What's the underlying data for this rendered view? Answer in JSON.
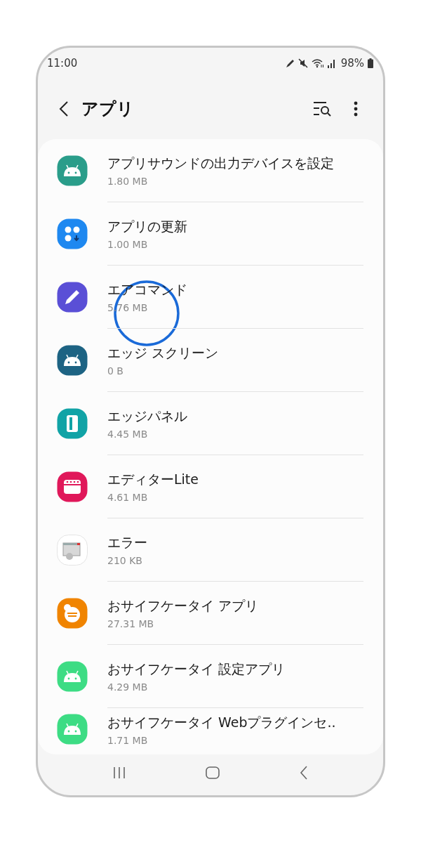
{
  "status_bar": {
    "time": "11:00",
    "battery": "98%"
  },
  "header": {
    "title": "アプリ"
  },
  "apps": [
    {
      "name": "アプリサウンドの出力デバイスを設定",
      "size": "1.80 MB",
      "kind": "android",
      "color": "#2a9d8a",
      "touched": false
    },
    {
      "name": "アプリの更新",
      "size": "1.00 MB",
      "kind": "dots",
      "color": "#1e88f0",
      "touched": false
    },
    {
      "name": "エアコマンド",
      "size": "5.76 MB",
      "kind": "pencil",
      "color": "#5a4fd6",
      "touched": true
    },
    {
      "name": "エッジ スクリーン",
      "size": "0 B",
      "kind": "android",
      "color": "#1d6383",
      "touched": false
    },
    {
      "name": "エッジパネル",
      "size": "4.45 MB",
      "kind": "panel",
      "color": "#11a3a6",
      "touched": false
    },
    {
      "name": "エディターLite",
      "size": "4.61 MB",
      "kind": "editor",
      "color": "#e0185a",
      "touched": false
    },
    {
      "name": "エラー",
      "size": "210 KB",
      "kind": "error",
      "color": "#ffffff",
      "touched": false
    },
    {
      "name": "おサイフケータイ アプリ",
      "size": "27.31 MB",
      "kind": "osaifu",
      "color": "#f08400",
      "touched": false
    },
    {
      "name": "おサイフケータイ 設定アプリ",
      "size": "4.29 MB",
      "kind": "android",
      "color": "#3ddc84",
      "touched": false
    },
    {
      "name": "おサイフケータイ Webプラグインセ..",
      "size": "1.71 MB",
      "kind": "android",
      "color": "#3ddc84",
      "touched": false
    }
  ]
}
